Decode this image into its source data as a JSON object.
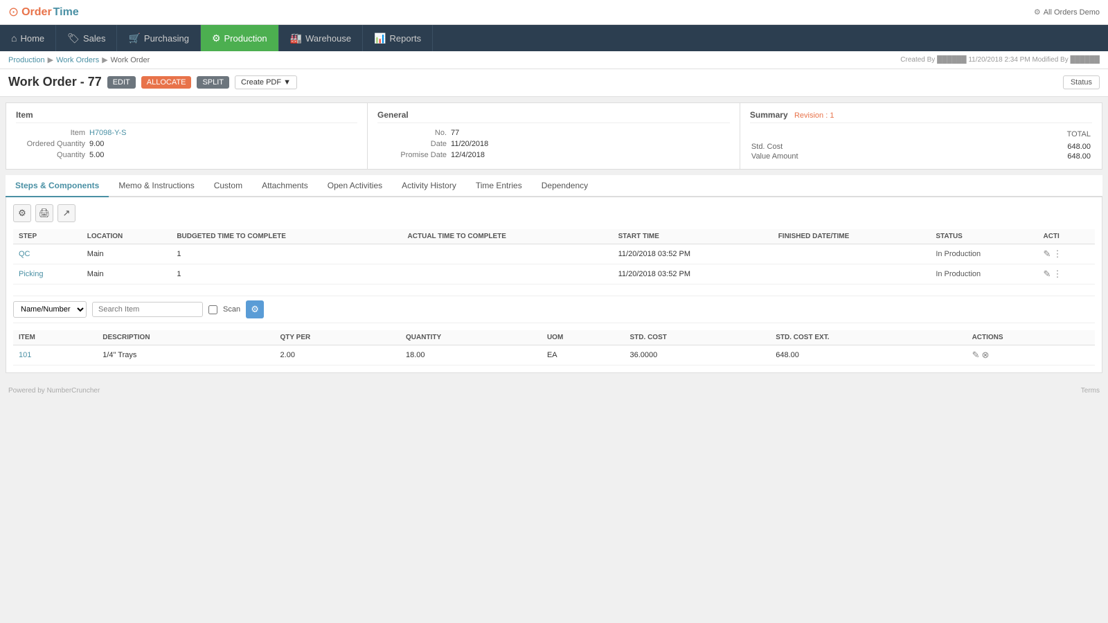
{
  "app": {
    "logo_order": "Order",
    "logo_time": "Time",
    "top_right_label": "All Orders Demo"
  },
  "nav": {
    "items": [
      {
        "id": "home",
        "label": "Home",
        "icon": "⌂",
        "active": false
      },
      {
        "id": "sales",
        "label": "Sales",
        "icon": "🏷",
        "active": false
      },
      {
        "id": "purchasing",
        "label": "Purchasing",
        "icon": "🛒",
        "active": false
      },
      {
        "id": "production",
        "label": "Production",
        "icon": "⚙",
        "active": true
      },
      {
        "id": "warehouse",
        "label": "Warehouse",
        "icon": "🏭",
        "active": false
      },
      {
        "id": "reports",
        "label": "Reports",
        "icon": "📊",
        "active": false
      }
    ]
  },
  "breadcrumb": {
    "items": [
      "Production",
      "Work Orders",
      "Work Order"
    ],
    "meta": "Created By ██████ 11/20/2018 2:34 PM   Modified By ██████"
  },
  "page": {
    "title": "Work Order - 77",
    "btn_edit": "EDIT",
    "btn_allocate": "ALLOCATE",
    "btn_split": "SPLIT",
    "btn_pdf": "Create PDF",
    "btn_status": "Status"
  },
  "item_panel": {
    "title": "Item",
    "item_label": "Item",
    "item_value": "H7098-Y-S",
    "ordered_qty_label": "Ordered Quantity",
    "ordered_qty_value": "9.00",
    "quantity_label": "Quantity",
    "quantity_value": "5.00"
  },
  "general_panel": {
    "title": "General",
    "no_label": "No.",
    "no_value": "77",
    "date_label": "Date",
    "date_value": "11/20/2018",
    "promise_date_label": "Promise Date",
    "promise_date_value": "12/4/2018"
  },
  "summary_panel": {
    "title": "Summary",
    "revision": "Revision : 1",
    "col_total": "TOTAL",
    "std_cost_label": "Std. Cost",
    "std_cost_value": "648.00",
    "value_amount_label": "Value Amount",
    "value_amount_value": "648.00"
  },
  "tabs": [
    {
      "id": "steps",
      "label": "Steps & Components",
      "active": true
    },
    {
      "id": "memo",
      "label": "Memo & Instructions",
      "active": false
    },
    {
      "id": "custom",
      "label": "Custom",
      "active": false
    },
    {
      "id": "attachments",
      "label": "Attachments",
      "active": false
    },
    {
      "id": "open_activities",
      "label": "Open Activities",
      "active": false
    },
    {
      "id": "activity_history",
      "label": "Activity History",
      "active": false
    },
    {
      "id": "time_entries",
      "label": "Time Entries",
      "active": false
    },
    {
      "id": "dependency",
      "label": "Dependency",
      "active": false
    }
  ],
  "steps_table": {
    "columns": [
      "STEP",
      "LOCATION",
      "BUDGETED TIME TO COMPLETE",
      "ACTUAL TIME TO COMPLETE",
      "START TIME",
      "FINISHED DATE/TIME",
      "STATUS",
      "ACTI"
    ],
    "rows": [
      {
        "step": "QC",
        "location": "Main",
        "budgeted": "1",
        "actual": "",
        "start_time": "11/20/2018 03:52 PM",
        "finished": "",
        "status": "In Production"
      },
      {
        "step": "Picking",
        "location": "Main",
        "budgeted": "1",
        "actual": "",
        "start_time": "11/20/2018 03:52 PM",
        "finished": "",
        "status": "In Production"
      }
    ]
  },
  "filter": {
    "select_label": "Name/Number",
    "search_placeholder": "Search Item",
    "scan_label": "Scan"
  },
  "components_table": {
    "columns": [
      "ITEM",
      "DESCRIPTION",
      "QTY PER",
      "QUANTITY",
      "UOM",
      "STD. COST",
      "STD. COST EXT.",
      "ACTIONS"
    ],
    "rows": [
      {
        "item": "101",
        "description": "1/4\" Trays",
        "qty_per": "2.00",
        "quantity": "18.00",
        "uom": "EA",
        "std_cost": "36.0000",
        "std_cost_ext": "648.00"
      }
    ]
  },
  "footer": {
    "powered_by": "Powered by NumberCruncher",
    "terms": "Terms"
  }
}
